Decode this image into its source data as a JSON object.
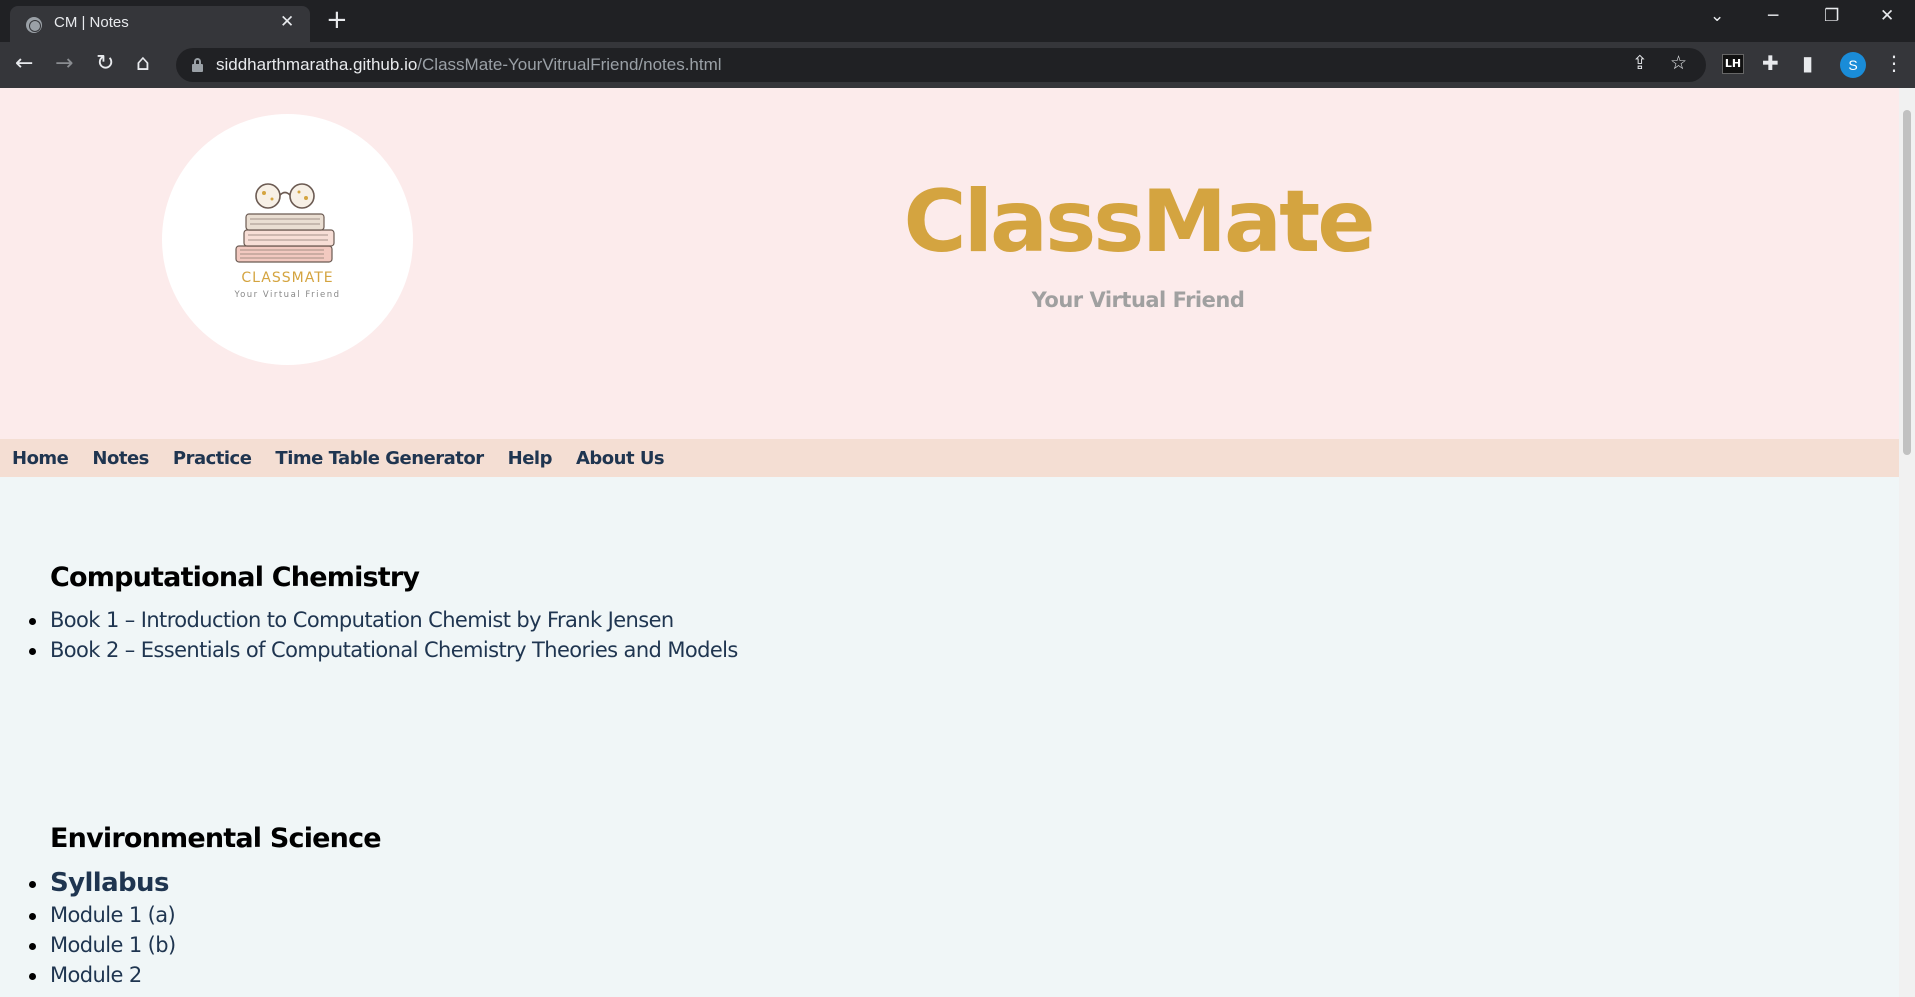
{
  "browser": {
    "tab_title": "CM | Notes",
    "url_host": "siddharthmaratha.github.io",
    "url_path": "/ClassMate-YourVitrualFriend/notes.html",
    "profile_initial": "S",
    "extension_badge": "LH"
  },
  "header": {
    "logo_text": "CLASSMATE",
    "logo_subtext": "Your Virtual Friend",
    "title": "ClassMate",
    "subtitle": "Your Virtual Friend"
  },
  "nav": {
    "items": [
      {
        "label": "Home"
      },
      {
        "label": "Notes"
      },
      {
        "label": "Practice"
      },
      {
        "label": "Time Table Generator"
      },
      {
        "label": "Help"
      },
      {
        "label": "About Us"
      }
    ]
  },
  "sections": [
    {
      "heading": "Computational Chemistry",
      "links": [
        {
          "label": "Book 1 – Introduction to Computation Chemist by Frank Jensen"
        },
        {
          "label": "Book 2 – Essentials of Computational Chemistry Theories and Models"
        }
      ]
    },
    {
      "heading": "Environmental Science",
      "links": [
        {
          "label": "Syllabus"
        },
        {
          "label": "Module 1 (a)"
        },
        {
          "label": "Module 1 (b)"
        },
        {
          "label": "Module 2"
        }
      ]
    }
  ],
  "colors": {
    "header_bg": "#fcebeb",
    "nav_bg": "#f4ded3",
    "page_bg": "#f0f6f7",
    "brand_gold": "#d4a440",
    "link_navy": "#1f3550"
  }
}
